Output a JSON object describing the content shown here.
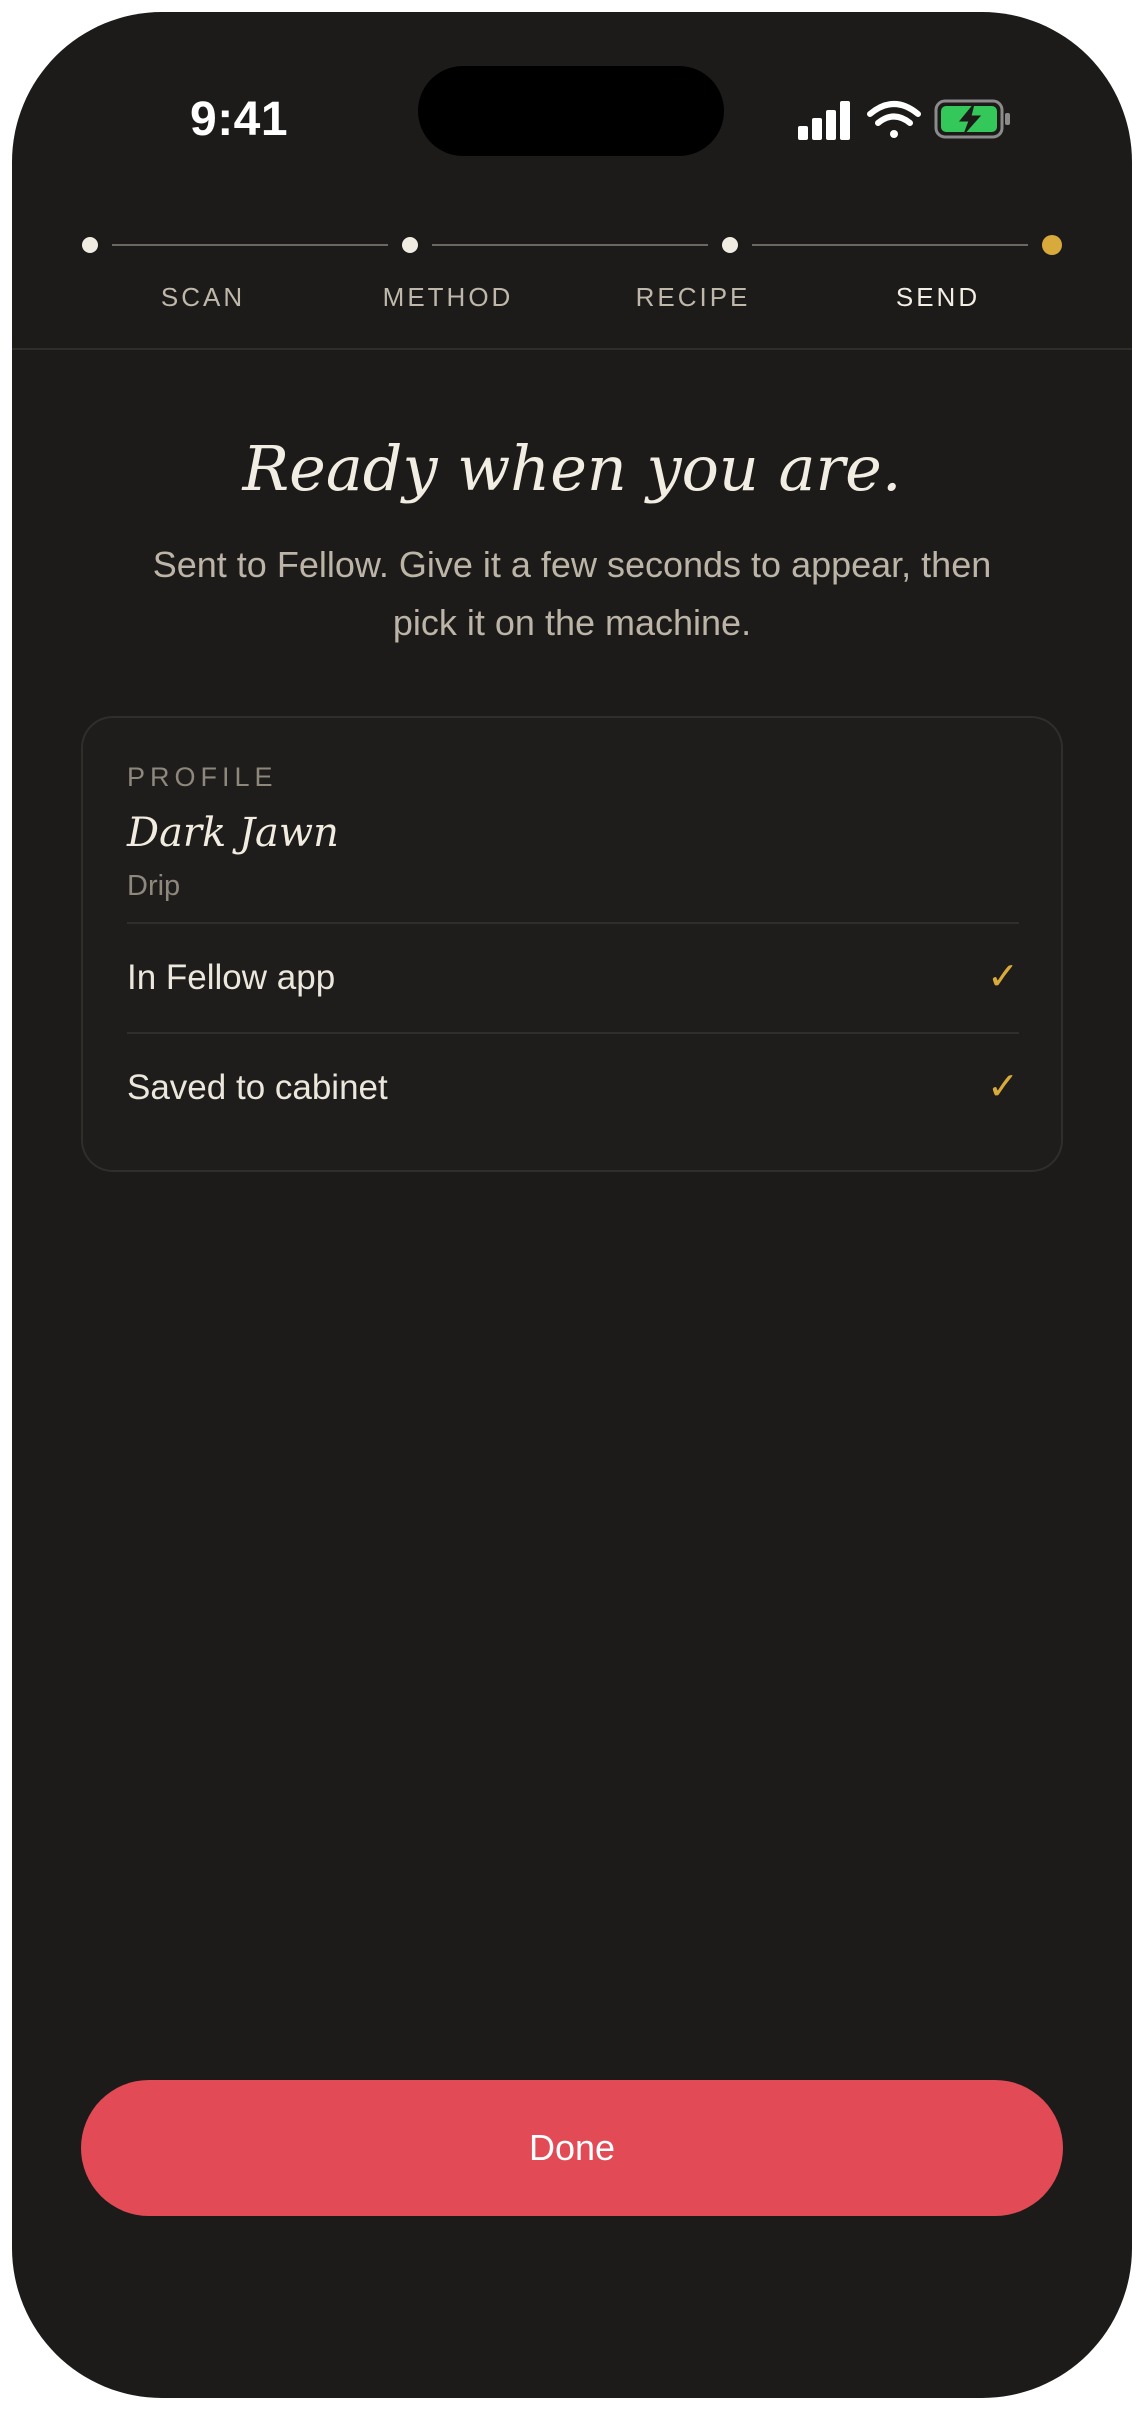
{
  "status_bar": {
    "time": "9:41",
    "icons": [
      "cellular-signal-icon",
      "wifi-icon",
      "battery-charging-icon"
    ]
  },
  "stepper": {
    "steps": [
      {
        "label": "SCAN",
        "state": "done"
      },
      {
        "label": "METHOD",
        "state": "done"
      },
      {
        "label": "RECIPE",
        "state": "done"
      },
      {
        "label": "SEND",
        "state": "active"
      }
    ]
  },
  "main": {
    "headline": "Ready when you are.",
    "subtext": "Sent to Fellow. Give it a few seconds to appear, then pick it on the machine."
  },
  "profile_card": {
    "label": "PROFILE",
    "name": "Dark Jawn",
    "type": "Drip",
    "rows": [
      {
        "label": "In Fellow app",
        "status_icon": "checkmark-icon"
      },
      {
        "label": "Saved to cabinet",
        "status_icon": "checkmark-icon"
      }
    ]
  },
  "footer": {
    "done_label": "Done"
  },
  "colors": {
    "background": "#1c1b19",
    "accent_gold": "#d8aa3c",
    "button_red": "#e24b55",
    "battery_green": "#34c759"
  }
}
